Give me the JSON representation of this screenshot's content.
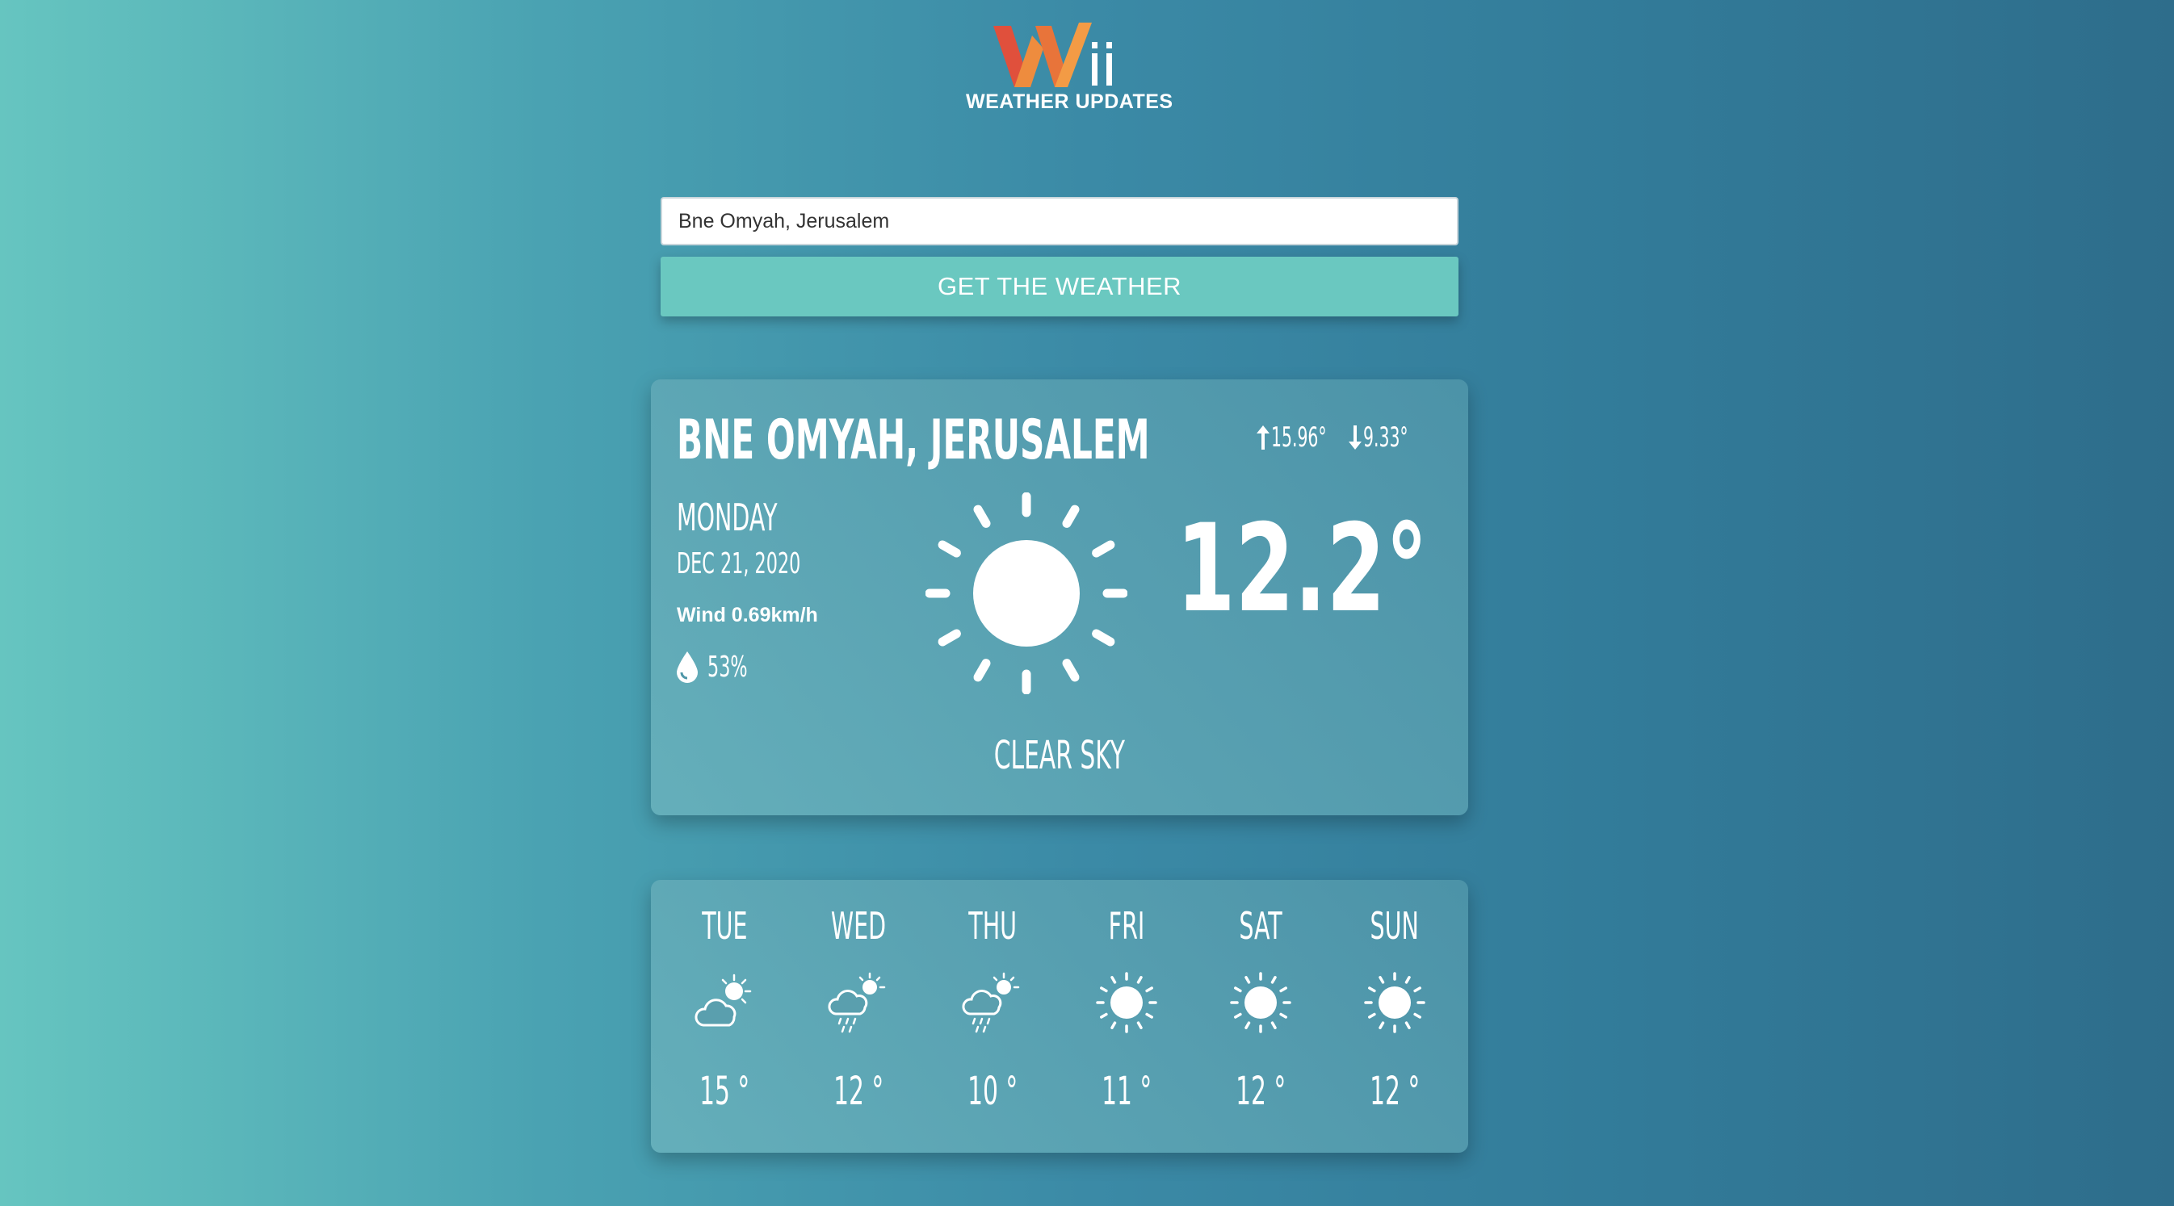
{
  "brand": {
    "logo_letters": "ii",
    "tagline": "WEATHER UPDATES"
  },
  "search": {
    "value": "Bne Omyah, Jerusalem",
    "button_label": "GET THE WEATHER"
  },
  "current": {
    "city": "BNE OMYAH, JERUSALEM",
    "temp_max": "15.96°",
    "temp_min": "9.33°",
    "day": "MONDAY",
    "date": "DEC 21, 2020",
    "wind": "Wind 0.69km/h",
    "humidity": "53%",
    "temperature": "12.2°",
    "condition": "CLEAR SKY",
    "icon": "sun-icon"
  },
  "forecast": [
    {
      "day": "TUE",
      "temp": "15 °",
      "icon": "partly-cloudy-icon"
    },
    {
      "day": "WED",
      "temp": "12 °",
      "icon": "rain-sun-icon"
    },
    {
      "day": "THU",
      "temp": "10 °",
      "icon": "rain-sun-icon"
    },
    {
      "day": "FRI",
      "temp": "11 °",
      "icon": "sun-icon"
    },
    {
      "day": "SAT",
      "temp": "12 °",
      "icon": "sun-icon"
    },
    {
      "day": "SUN",
      "temp": "12 °",
      "icon": "sun-icon"
    }
  ],
  "colors": {
    "button": "#6ac8c0",
    "logo_orange": "#e8743a",
    "logo_red": "#e0503c"
  }
}
